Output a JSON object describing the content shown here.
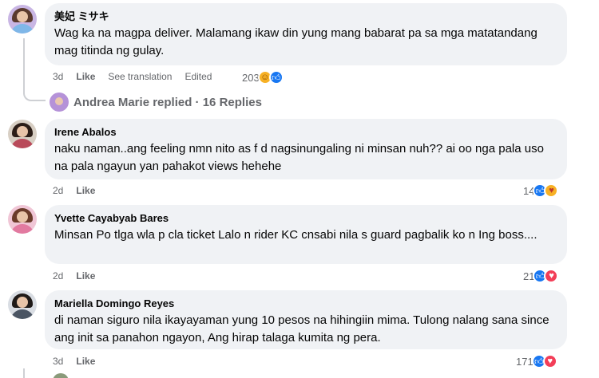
{
  "comments": [
    {
      "author": "美妃 ミサキ",
      "text": "Wag ka na magpa deliver. Malamang ikaw din yung mang babarat pa sa mga matatandang mag titinda ng gulay.",
      "time": "3d",
      "like_label": "Like",
      "translate_label": "See translation",
      "edited_label": "Edited",
      "reaction_count": "203",
      "reactions": [
        "haha-icon",
        "like-icon"
      ]
    },
    {
      "author": "Irene Abalos",
      "text": "naku naman..ang feeling nmn nito as f d nagsinungaling ni minsan nuh?? ai oo nga pala uso na pala ngayun yan pahakot views hehehe",
      "time": "2d",
      "like_label": "Like",
      "reaction_count": "14",
      "reactions": [
        "like-icon",
        "care-icon"
      ]
    },
    {
      "author": "Yvette Cayabyab Bares",
      "text": "Minsan Po tlga wla p cla ticket Lalo n rider KC cnsabi nila s guard pagbalik ko n Ing boss....",
      "time": "2d",
      "like_label": "Like",
      "reaction_count": "21",
      "reactions": [
        "like-icon",
        "love-icon"
      ]
    },
    {
      "author": "Mariella Domingo Reyes",
      "text": "di naman siguro nila ikayayaman yung 10 pesos na hihingiin mima. Tulong nalang sana since ang init sa panahon ngayon, Ang hirap talaga kumita ng pera.",
      "time": "3d",
      "like_label": "Like",
      "reaction_count": "171",
      "reactions": [
        "like-icon",
        "love-icon"
      ]
    }
  ],
  "reply_link": "Andrea Marie replied · 16 Replies",
  "colors": {
    "bubble": "#f0f2f5",
    "meta_text": "#65676b",
    "like_blue": "#1877f2",
    "love_red": "#f33e58",
    "haha_yellow": "#f7b125"
  }
}
